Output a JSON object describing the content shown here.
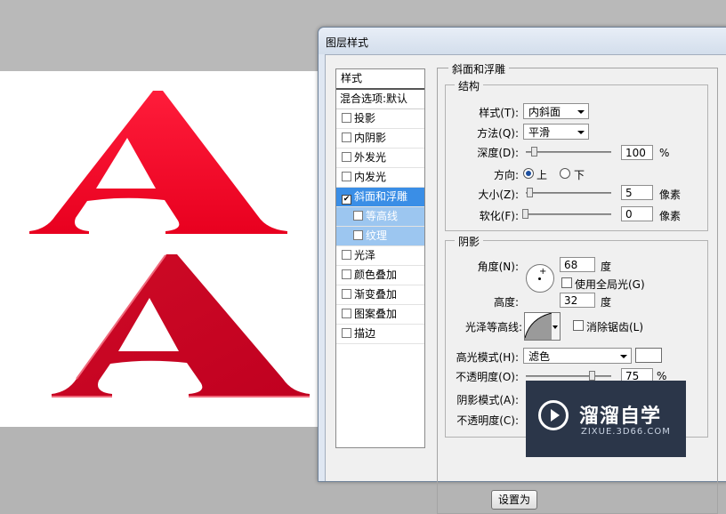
{
  "dialog": {
    "title": "图层样式"
  },
  "styles_panel": {
    "header": "样式",
    "blend_options": "混合选项:默认",
    "items": [
      {
        "label": "投影",
        "checked": false
      },
      {
        "label": "内阴影",
        "checked": false
      },
      {
        "label": "外发光",
        "checked": false
      },
      {
        "label": "内发光",
        "checked": false
      },
      {
        "label": "斜面和浮雕",
        "checked": true,
        "selected": true
      },
      {
        "label": "等高线",
        "checked": false,
        "sub": true
      },
      {
        "label": "纹理",
        "checked": false,
        "sub": true
      },
      {
        "label": "光泽",
        "checked": false
      },
      {
        "label": "颜色叠加",
        "checked": false
      },
      {
        "label": "渐变叠加",
        "checked": false
      },
      {
        "label": "图案叠加",
        "checked": false
      },
      {
        "label": "描边",
        "checked": false
      }
    ]
  },
  "bevel": {
    "section_title": "斜面和浮雕",
    "structure": {
      "title": "结构",
      "style_label": "样式(T):",
      "style_value": "内斜面",
      "technique_label": "方法(Q):",
      "technique_value": "平滑",
      "depth_label": "深度(D):",
      "depth_value": "100",
      "depth_unit": "%",
      "depth_level": 1.0,
      "direction_label": "方向:",
      "direction_up": "上",
      "direction_down": "下",
      "size_label": "大小(Z):",
      "size_value": "5",
      "size_unit": "像素",
      "soften_label": "软化(F):",
      "soften_value": "0",
      "soften_unit": "像素"
    },
    "shading": {
      "title": "阴影",
      "angle_label": "角度(N):",
      "angle_value": "68",
      "angle_unit": "度",
      "global_light_label": "使用全局光(G)",
      "altitude_label": "高度:",
      "altitude_value": "32",
      "altitude_unit": "度",
      "gloss_contour_label": "光泽等高线:",
      "anti_aliased_label": "消除锯齿(L)",
      "highlight_mode_label": "高光模式(H):",
      "highlight_mode_value": "滤色",
      "highlight_color": "#ffffff",
      "highlight_opacity_label": "不透明度(O):",
      "highlight_opacity_value": "75",
      "highlight_opacity_unit": "%",
      "shadow_mode_label": "阴影模式(A):",
      "shadow_opacity_label": "不透明度(C):"
    },
    "reset_button": "设置为"
  },
  "canvas": {
    "letter": "A",
    "letter_color_top": "#f0102e",
    "letter_color_bottom": "#cc0022"
  },
  "watermark": {
    "title": "溜溜自学",
    "subtitle": "ZIXUE.3D66.COM"
  }
}
